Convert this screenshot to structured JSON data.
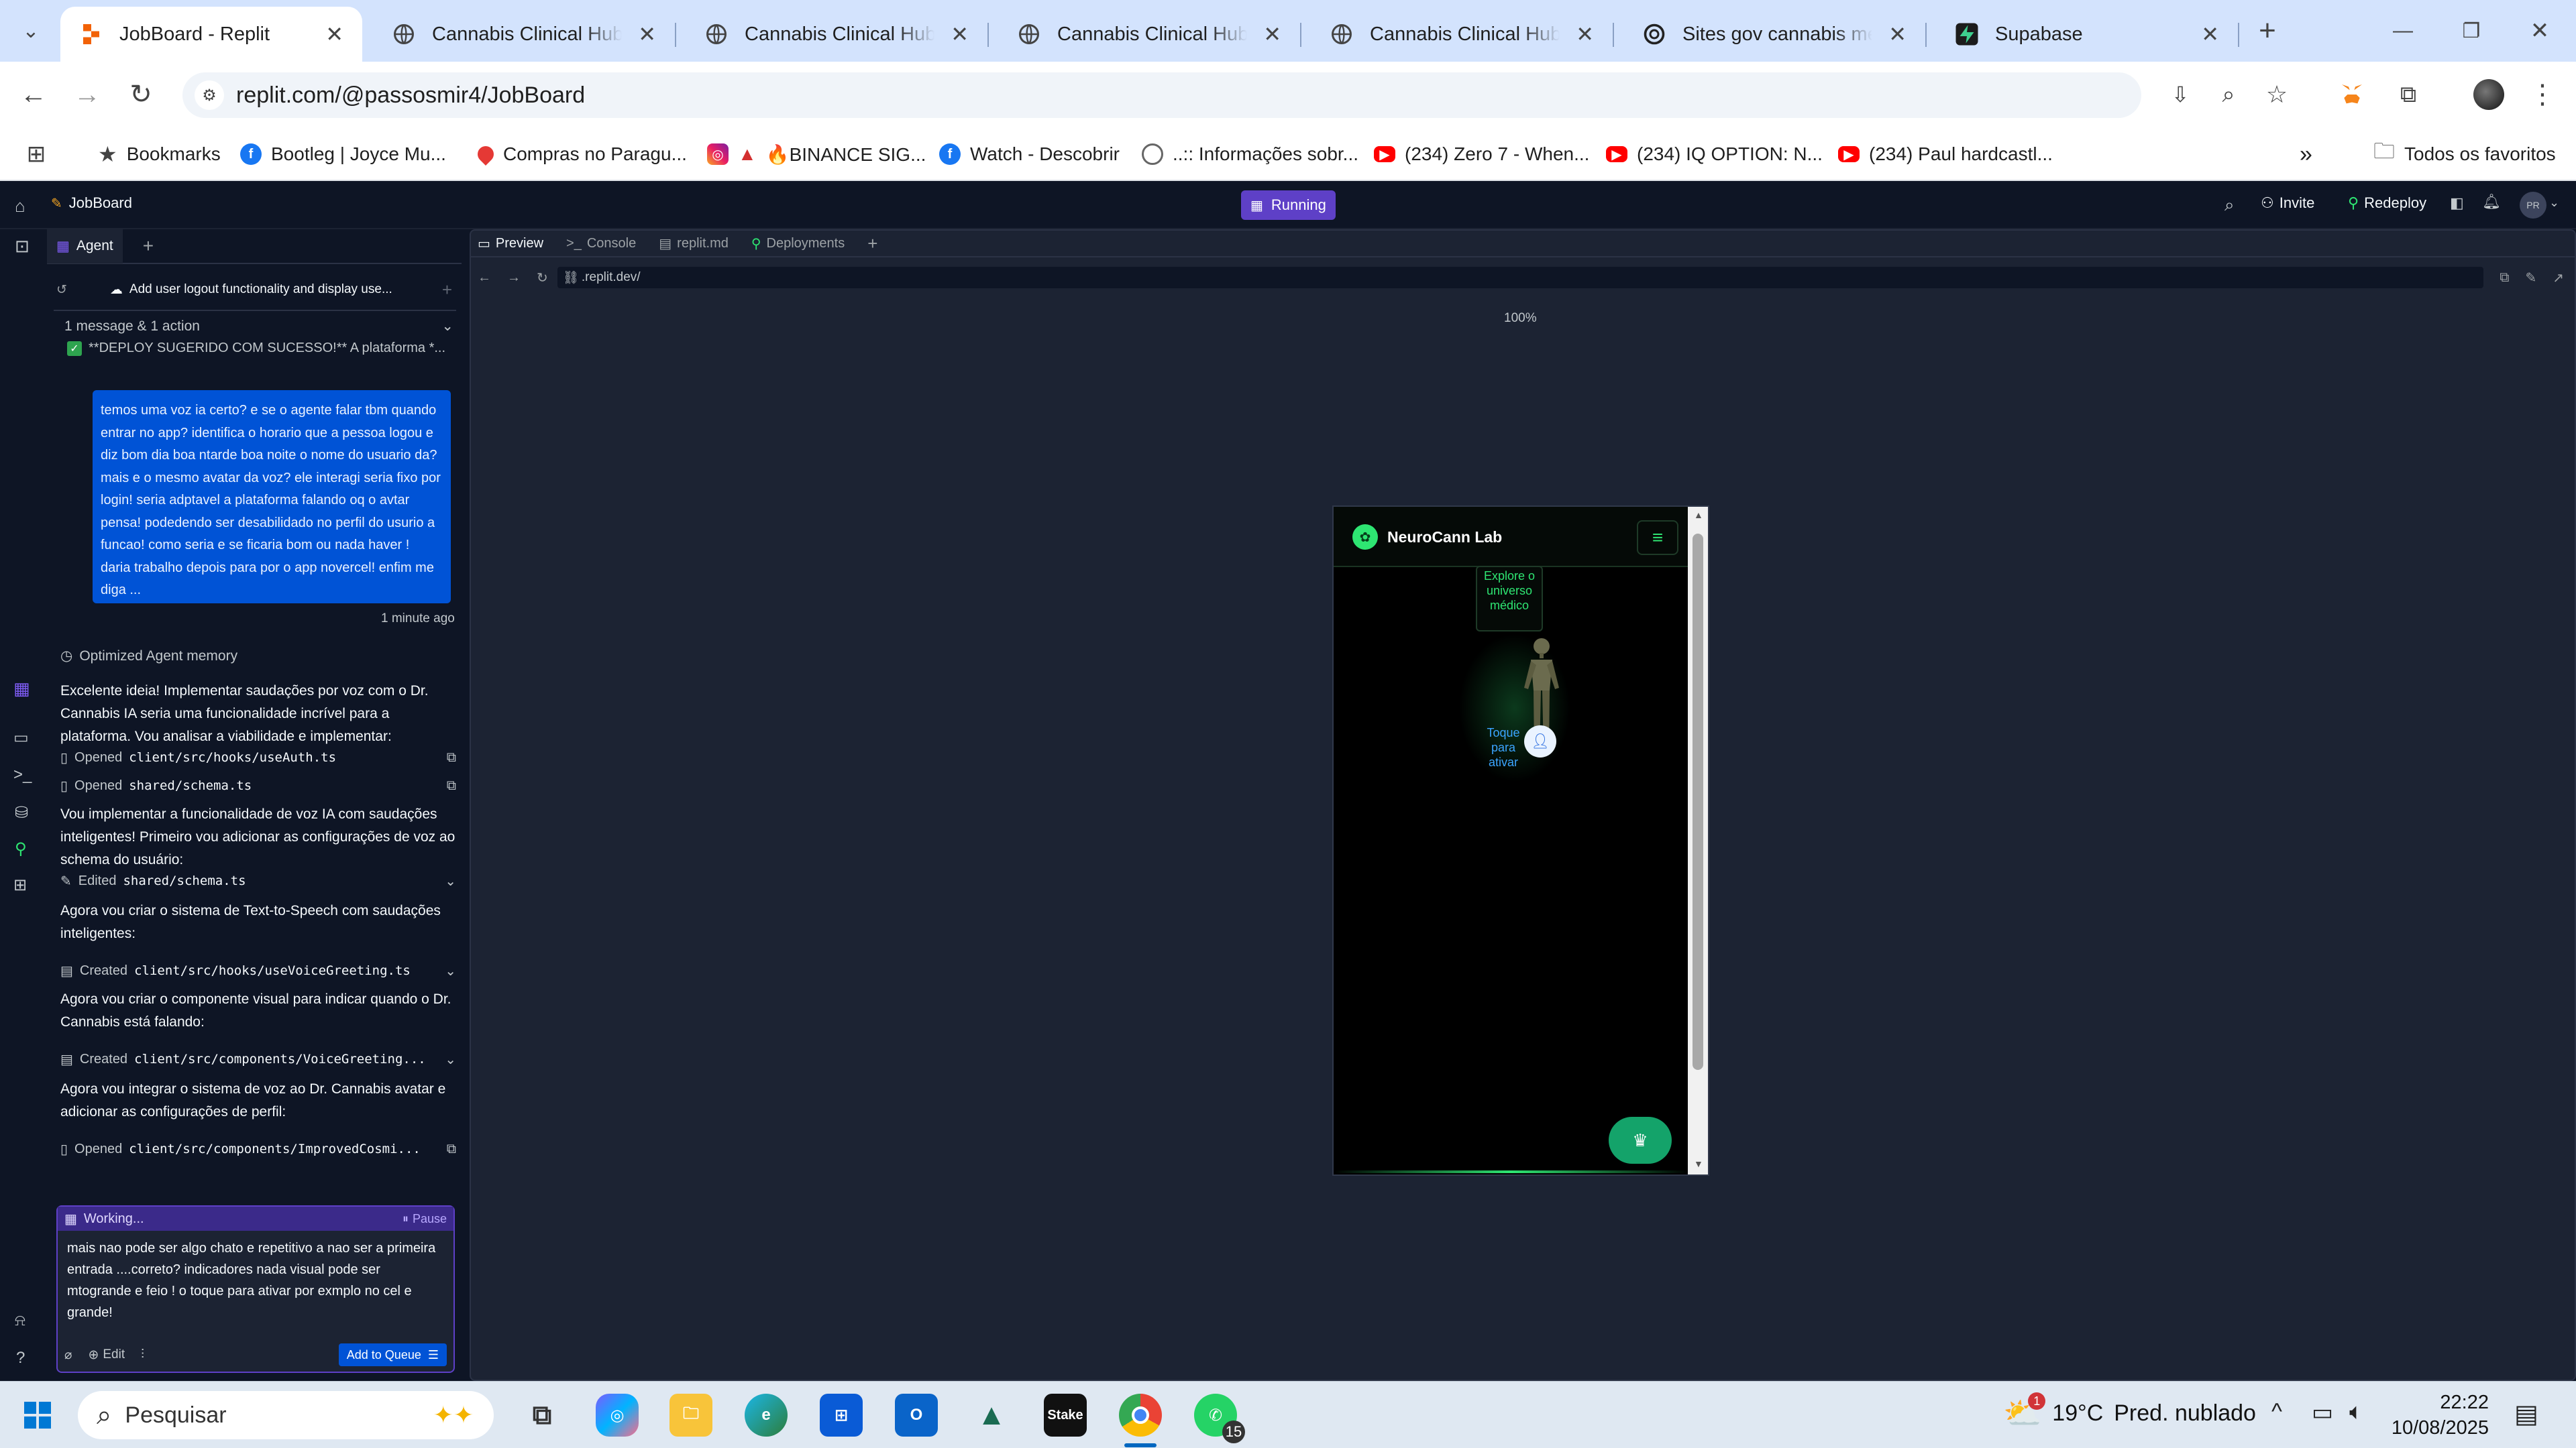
{
  "browser": {
    "tabs": [
      {
        "title": "JobBoard - Replit",
        "active": true
      },
      {
        "title": "Cannabis Clinical Hub - Pl"
      },
      {
        "title": "Cannabis Clinical Hub - Pl"
      },
      {
        "title": "Cannabis Clinical Hub - Pl"
      },
      {
        "title": "Cannabis Clinical Hub - Pl"
      },
      {
        "title": "Sites gov cannabis médic"
      },
      {
        "title": "Supabase"
      }
    ],
    "url": "replit.com/@passosmir4/JobBoard",
    "bookmarks": [
      {
        "label": "Bookmarks"
      },
      {
        "label": "Bootleg | Joyce Mu..."
      },
      {
        "label": "Compras no Paragu..."
      },
      {
        "label": "🔥BINANCE SIG..."
      },
      {
        "label": "Watch - Descobrir"
      },
      {
        "label": "..:: Informações sobr..."
      },
      {
        "label": "(234) Zero 7 - When..."
      },
      {
        "label": "(234) IQ OPTION: N..."
      },
      {
        "label": "(234) Paul hardcastl..."
      }
    ],
    "all_bookmarks": "Todos os favoritos"
  },
  "replit": {
    "project": "JobBoard",
    "status": "Running",
    "invite": "Invite",
    "redeploy": "Redeploy",
    "avatar_initials": "PR",
    "agent_tab": "Agent",
    "preview_tabs": [
      {
        "label": "Preview",
        "active": true
      },
      {
        "label": "Console"
      },
      {
        "label": "replit.md"
      },
      {
        "label": "Deployments"
      }
    ],
    "preview_url": ".replit.dev/",
    "zoom": "100%"
  },
  "agent": {
    "checkpoint_title": "Add user logout functionality and display use...",
    "summary": "1 message & 1 action",
    "deploy_note": "**DEPLOY SUGERIDO COM SUCESSO!** A plataforma *...",
    "user_message": "temos uma voz ia certo? e se o agente falar tbm quando entrar no app? identifica o horario que a pessoa logou e diz bom dia boa ntarde boa noite o nome do usuario da? mais e o mesmo avatar da voz? ele interagi seria fixo por login! seria adptavel a plataforma falando oq o avtar pensa! podedendo ser desabilidado no perfil do usurio a funcao! como seria e se ficaria bom ou nada haver ! daria trabalho depois para por o app novercel! enfim me diga ...",
    "user_time": "1 minute ago",
    "memory": "Optimized Agent memory",
    "steps": [
      {
        "type": "text",
        "text": "Excelente ideia! Implementar saudações por voz com o Dr. Cannabis IA seria uma funcionalidade incrível para a plataforma. Vou analisar a viabilidade e implementar:"
      },
      {
        "type": "file",
        "action": "Opened",
        "path": "client/src/hooks/useAuth.ts"
      },
      {
        "type": "file",
        "action": "Opened",
        "path": "shared/schema.ts"
      },
      {
        "type": "text",
        "text": "Vou implementar a funcionalidade de voz IA com saudações inteligentes! Primeiro vou adicionar as configurações de voz ao schema do usuário:"
      },
      {
        "type": "file",
        "action": "Edited",
        "path": "shared/schema.ts"
      },
      {
        "type": "text",
        "text": "Agora vou criar o sistema de Text-to-Speech com saudações inteligentes:"
      },
      {
        "type": "file",
        "action": "Created",
        "path": "client/src/hooks/useVoiceGreeting.ts"
      },
      {
        "type": "text",
        "text": "Agora vou criar o componente visual para indicar quando o Dr. Cannabis está falando:"
      },
      {
        "type": "file",
        "action": "Created",
        "path": "client/src/components/VoiceGreeting..."
      },
      {
        "type": "text",
        "text": "Agora vou integrar o sistema de voz ao Dr. Cannabis avatar e adicionar as configurações de perfil:"
      },
      {
        "type": "file",
        "action": "Opened",
        "path": "client/src/components/ImprovedCosmi..."
      }
    ],
    "working": "Working...",
    "pause": "Pause",
    "input_text": "mais nao pode ser algo chato e repetitivo a nao ser a primeira entrada ....correto? indicadores nada visual pode ser mtogrande e feio ! o toque para ativar por exmplo no cel e grande!",
    "edit": "Edit",
    "add_to_queue": "Add to Queue"
  },
  "app": {
    "brand": "NeuroCann Lab",
    "tooltip": "Explore o universo médico",
    "tap_hint": "Toque para ativar"
  },
  "taskbar": {
    "search": "Pesquisar",
    "weather_temp": "19°C",
    "weather_desc": "Pred. nublado",
    "time": "22:22",
    "date": "10/08/2025",
    "whatsapp_badge": "15",
    "weather_badge": "1"
  },
  "colors": {
    "accent": "#0053d6",
    "running": "#5e40c7",
    "app_green": "#2ee572"
  }
}
